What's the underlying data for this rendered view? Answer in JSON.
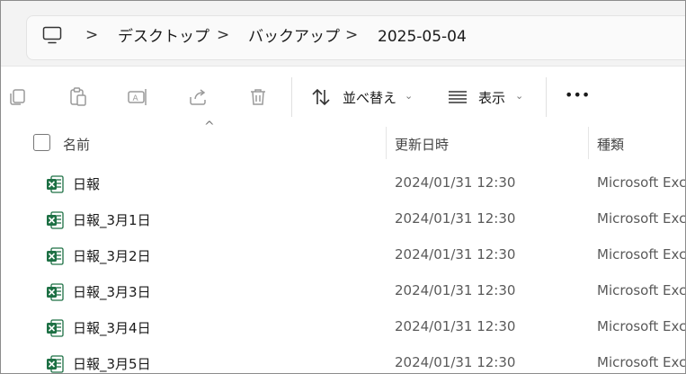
{
  "breadcrumb": {
    "items": [
      "デスクトップ",
      "バックアップ",
      "2025-05-04"
    ],
    "separator": ">"
  },
  "toolbar": {
    "sort_label": "並べ替え",
    "view_label": "表示",
    "more_label": "•••"
  },
  "columns": {
    "name": "名前",
    "date": "更新日時",
    "type": "種類"
  },
  "files": [
    {
      "name": "日報",
      "date": "2024/01/31 12:30",
      "type": "Microsoft Exc"
    },
    {
      "name": "日報_3月1日",
      "date": "2024/01/31 12:30",
      "type": "Microsoft Exc"
    },
    {
      "name": "日報_3月2日",
      "date": "2024/01/31 12:30",
      "type": "Microsoft Exc"
    },
    {
      "name": "日報_3月3日",
      "date": "2024/01/31 12:30",
      "type": "Microsoft Exc"
    },
    {
      "name": "日報_3月4日",
      "date": "2024/01/31 12:30",
      "type": "Microsoft Exc"
    },
    {
      "name": "日報_3月5日",
      "date": "2024/01/31 12:30",
      "type": "Microsoft Exc"
    }
  ],
  "icons": {
    "computer": "computer-icon",
    "file": "excel-file-icon"
  },
  "colors": {
    "excel_green": "#1d7044",
    "toolbar_icon_disabled": "#9a9a9a"
  }
}
